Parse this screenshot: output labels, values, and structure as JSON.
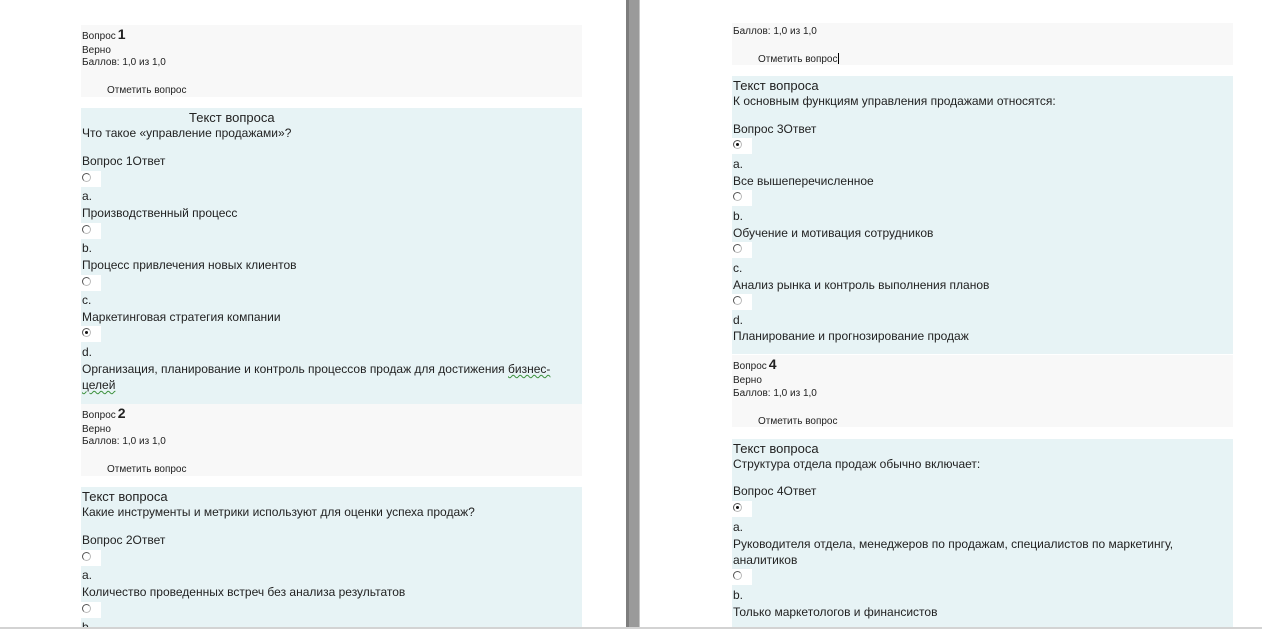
{
  "labels": {
    "question": "Вопрос",
    "correct": "Верно",
    "score": "Баллов: 1,0 из 1,0",
    "flag": "Отметить вопрос",
    "question_text_header": "Текст вопроса"
  },
  "left": {
    "q1": {
      "number": "1",
      "text": "Что такое «управление  продажами»?",
      "answer_header": "Вопрос 1Ответ",
      "options": [
        {
          "letter": "a.",
          "text": "Производственный процесс",
          "selected": false
        },
        {
          "letter": "b.",
          "text": "Процесс привлечения  новых клиентов",
          "selected": false
        },
        {
          "letter": "c.",
          "text": "Маркетинговая  стратегия компании",
          "selected": false
        },
        {
          "letter": "d.",
          "text_line1_part1": "Организация,  планирование  и контроль  процессов  продаж для достижения ",
          "text_line1_spell": "бизнес-",
          "text_line2_spell": "целей",
          "selected": true
        }
      ]
    },
    "q2": {
      "number": "2",
      "text": "Какие инструменты  и метрики  используют для оценки  успеха продаж?",
      "answer_header": "Вопрос 2Ответ",
      "options": [
        {
          "letter": "a.",
          "text": "Количество  проведенных  встреч без анализа  результатов",
          "selected": false
        },
        {
          "letter": "b.",
          "text": "",
          "selected": false
        }
      ]
    }
  },
  "right": {
    "q2_score": "Баллов: 1,0 из 1,0",
    "q2_flag": "Отметить вопрос",
    "q3": {
      "text": "К основным функциям управления  продажами относятся:",
      "answer_header": "Вопрос 3Ответ",
      "options": [
        {
          "letter": "a.",
          "text": "Все вышеперечисленное",
          "selected": true
        },
        {
          "letter": "b.",
          "text": "Обучение  и мотивация  сотрудников",
          "selected": false
        },
        {
          "letter": "c.",
          "text": "Анализ рынка и контроль  выполнения  планов",
          "selected": false
        },
        {
          "letter": "d.",
          "text": "Планирование  и прогнозирование  продаж",
          "selected": false
        }
      ]
    },
    "q4": {
      "number": "4",
      "text": "Структура  отдела продаж  обычно включает:",
      "answer_header": "Вопрос 4Ответ",
      "options": [
        {
          "letter": "a.",
          "text_line1": "Руководителя отдела,  менеджеров  по продажам,  специалистов  по маркетингу,",
          "text_line2": "аналитиков",
          "selected": true
        },
        {
          "letter": "b.",
          "text": "Только  маркетологов  и финансистов",
          "selected": false
        }
      ]
    }
  },
  "colors": {
    "info_bg": "#f8f8f8",
    "question_bg": "#e7f3f5",
    "gutter": "#9a9a9a",
    "spellcheck_underline": "#3a8f3a"
  }
}
